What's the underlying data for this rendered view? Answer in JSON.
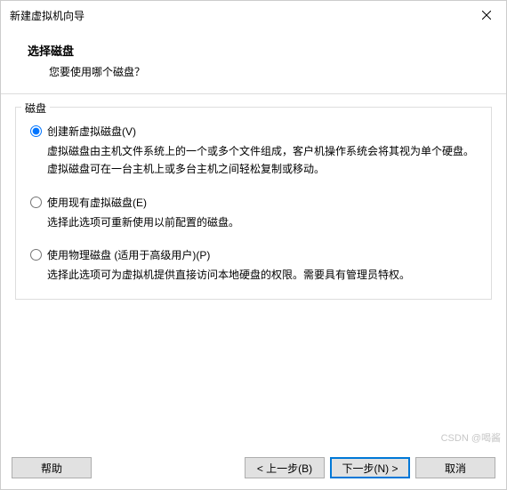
{
  "window": {
    "title": "新建虚拟机向导"
  },
  "header": {
    "title": "选择磁盘",
    "subtitle": "您要使用哪个磁盘？"
  },
  "group": {
    "legend": "磁盘"
  },
  "options": [
    {
      "label": "创建新虚拟磁盘(V)",
      "desc": "虚拟磁盘由主机文件系统上的一个或多个文件组成，客户机操作系统会将其视为单个硬盘。虚拟磁盘可在一台主机上或多台主机之间轻松复制或移动。",
      "selected": true
    },
    {
      "label": "使用现有虚拟磁盘(E)",
      "desc": "选择此选项可重新使用以前配置的磁盘。",
      "selected": false
    },
    {
      "label": "使用物理磁盘 (适用于高级用户)(P)",
      "desc": "选择此选项可为虚拟机提供直接访问本地硬盘的权限。需要具有管理员特权。",
      "selected": false
    }
  ],
  "footer": {
    "help": "帮助",
    "back": "< 上一步(B)",
    "next": "下一步(N) >",
    "cancel": "取消"
  },
  "watermark": "CSDN @喝酱"
}
